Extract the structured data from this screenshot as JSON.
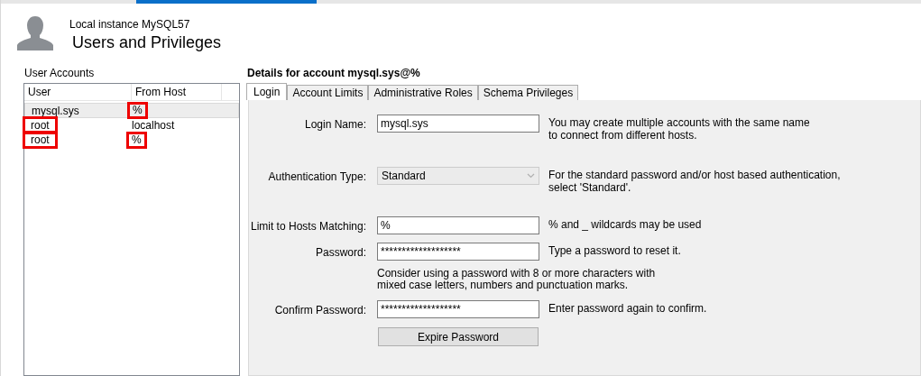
{
  "header": {
    "subtitle": "Local instance MySQL57",
    "title": "Users and Privileges"
  },
  "accounts": {
    "label": "User Accounts",
    "columns": [
      "User",
      "From Host"
    ],
    "rows": [
      {
        "user": "mysql.sys",
        "host": "%",
        "selected": true,
        "user_marked": false,
        "host_marked": true
      },
      {
        "user": "root",
        "host": "localhost",
        "selected": false,
        "user_marked": true,
        "host_marked": false
      },
      {
        "user": "root",
        "host": "%",
        "selected": false,
        "user_marked": true,
        "host_marked": true
      }
    ]
  },
  "details": {
    "title": "Details for account mysql.sys@%",
    "tabs": [
      {
        "label": "Login",
        "selected": true
      },
      {
        "label": "Account Limits",
        "selected": false
      },
      {
        "label": "Administrative Roles",
        "selected": false
      },
      {
        "label": "Schema Privileges",
        "selected": false
      }
    ],
    "fields": [
      {
        "kind": "text",
        "label": "Login Name:",
        "value": "mysql.sys",
        "note": "You may create multiple accounts with the same name\nto connect from different hosts."
      },
      {
        "kind": "select",
        "label": "Authentication Type:",
        "value": "Standard",
        "note": "For the standard password and/or host based authentication,\nselect 'Standard'."
      },
      {
        "kind": "text",
        "label": "Limit to Hosts Matching:",
        "value": "%",
        "note": "% and _ wildcards may be used"
      },
      {
        "kind": "text",
        "label": "Password:",
        "value": "*******************",
        "note": "Type a password to reset it."
      },
      {
        "kind": "hint",
        "text": "Consider using a password with 8 or more characters with\nmixed case letters, numbers and punctuation marks."
      },
      {
        "kind": "text",
        "label": "Confirm Password:",
        "value": "*******************",
        "note": "Enter password again to confirm."
      },
      {
        "kind": "button",
        "label": "Expire Password"
      }
    ]
  }
}
